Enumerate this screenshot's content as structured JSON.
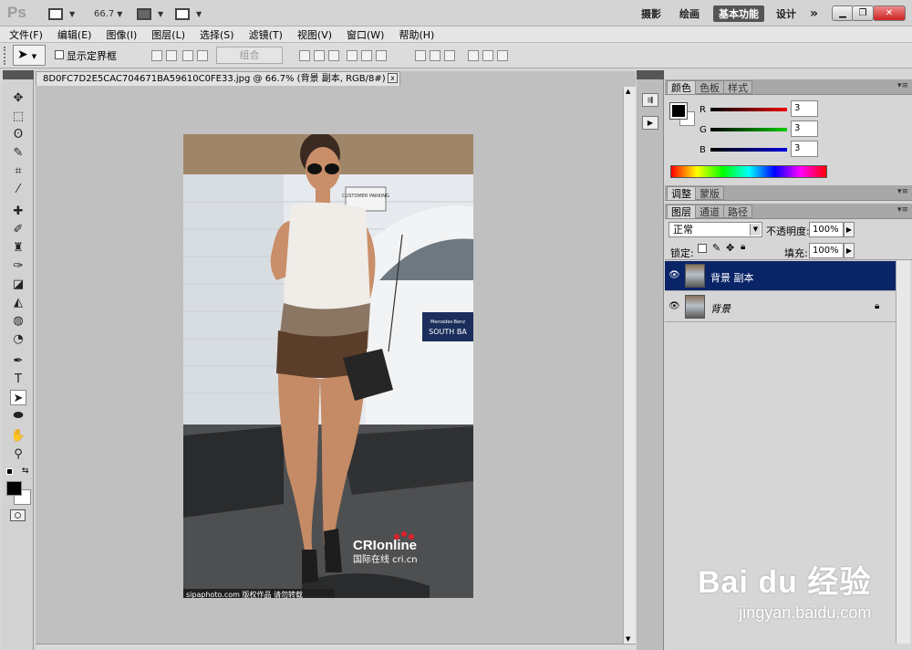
{
  "titlebar": {
    "logo": "Ps",
    "zoom_value": "66.7",
    "workspaces": [
      "摄影",
      "绘画",
      "基本功能",
      "设计"
    ],
    "active_workspace": "基本功能",
    "more": "»"
  },
  "menu": [
    "文件(F)",
    "编辑(E)",
    "图像(I)",
    "图层(L)",
    "选择(S)",
    "滤镜(T)",
    "视图(V)",
    "窗口(W)",
    "帮助(H)"
  ],
  "options": {
    "show_bounds_label": "显示定界框",
    "combine_label": "组合"
  },
  "document": {
    "tab_title": "8D0FC7D2E5CAC704671BA59610C0FE33.jpg @ 66.7% (背景 副本, RGB/8#) *",
    "close": "x",
    "photo_texts": {
      "sign": "CUSTOMER PARKING",
      "plate_top": "Mercedes-Benz",
      "plate_main": "SOUTH BA",
      "logo": "CRIonline",
      "logo_sub": "国际在线 cri.cn",
      "credit": "sipaphoto.com 版权作品 请勿转载"
    }
  },
  "color_panel": {
    "tabs": [
      "颜色",
      "色板",
      "样式"
    ],
    "active_tab": "颜色",
    "channels": [
      {
        "label": "R",
        "value": "3",
        "color": "#c00000"
      },
      {
        "label": "G",
        "value": "3",
        "color": "#00a000"
      },
      {
        "label": "B",
        "value": "3",
        "color": "#0000c0"
      }
    ]
  },
  "adjust_panel": {
    "tabs": [
      "调整",
      "蒙版"
    ],
    "active_tab": "调整"
  },
  "layers_panel": {
    "tabs": [
      "图层",
      "通道",
      "路径"
    ],
    "active_tab": "图层",
    "blend_mode": "正常",
    "opacity_label": "不透明度:",
    "opacity": "100%",
    "lock_label": "锁定:",
    "fill_label": "填充:",
    "fill": "100%",
    "layers": [
      {
        "name": "背景 副本",
        "selected": true,
        "locked": false
      },
      {
        "name": "背景",
        "selected": false,
        "locked": true
      }
    ]
  },
  "watermark": {
    "brand": "Bai du 经验",
    "url": "jingyan.baidu.com"
  }
}
